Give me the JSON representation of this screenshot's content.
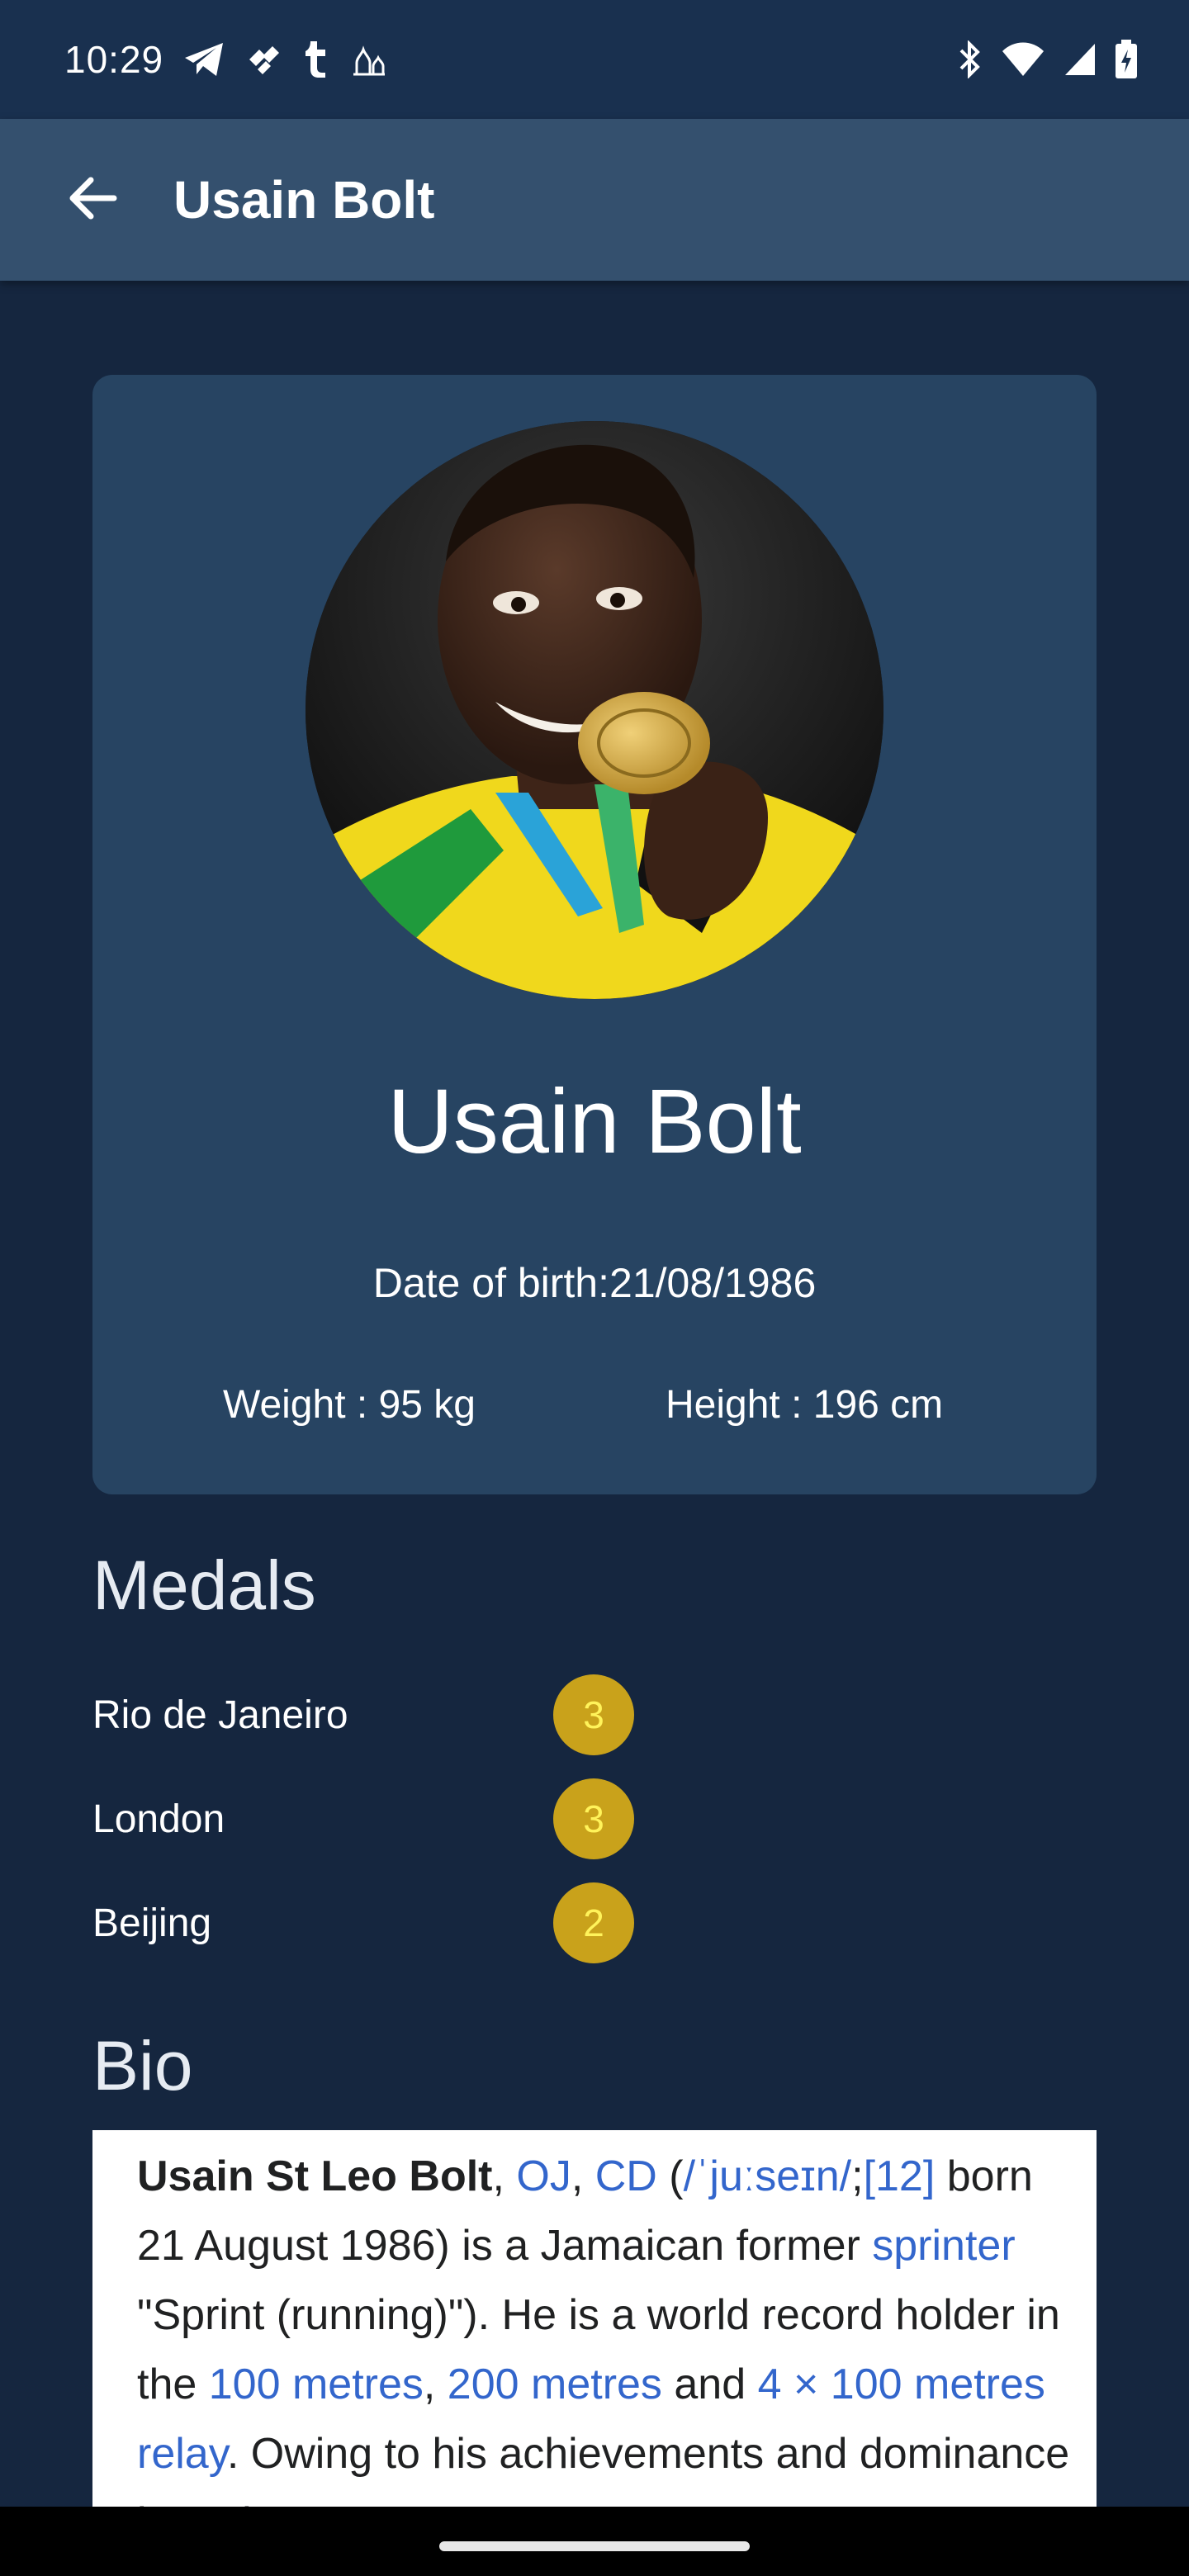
{
  "status_bar": {
    "time": "10:29",
    "left_icons": [
      "telegram-icon",
      "tidal-icon",
      "tumblr-icon",
      "ramadan-icon"
    ],
    "right_icons": [
      "bluetooth-icon",
      "wifi-icon",
      "signal-icon",
      "battery-charging-icon"
    ]
  },
  "app_bar": {
    "title": "Usain Bolt",
    "back_icon": "arrow-left-icon"
  },
  "profile": {
    "name": "Usain Bolt",
    "date_of_birth": "Date of birth:21/08/1986",
    "weight": "Weight : 95 kg",
    "height": "Height : 196 cm"
  },
  "medals": {
    "heading": "Medals",
    "items": [
      {
        "city": "Rio de Janeiro",
        "count": "3"
      },
      {
        "city": "London",
        "count": "3"
      },
      {
        "city": "Beijing",
        "count": "2"
      }
    ]
  },
  "bio": {
    "heading": "Bio",
    "name_bold": "Usain St Leo Bolt",
    "link_oj": "OJ",
    "link_cd": "CD",
    "link_pronunciation": "/ˈjuːseɪn/",
    "link_ref": "[12]",
    "text_born": "born 21 August 1986) is a Jamaican former",
    "link_sprinter": "sprinter",
    "text_sprint": "\"Sprint (running)\"). He is a world record holder in the",
    "link_100m": "100 metres",
    "link_200m": "200 metres",
    "text_and": "and",
    "link_relay": "4 × 100 metres relay",
    "text_owing": ". Owing to his achievements and dominance in sprint"
  },
  "colors": {
    "background": "#15263f",
    "status_bar": "#19304f",
    "app_bar": "#34506e",
    "card": "#274462",
    "medal_badge": "#c9a21b",
    "medal_number": "#fff35a",
    "link": "#3366cc"
  }
}
